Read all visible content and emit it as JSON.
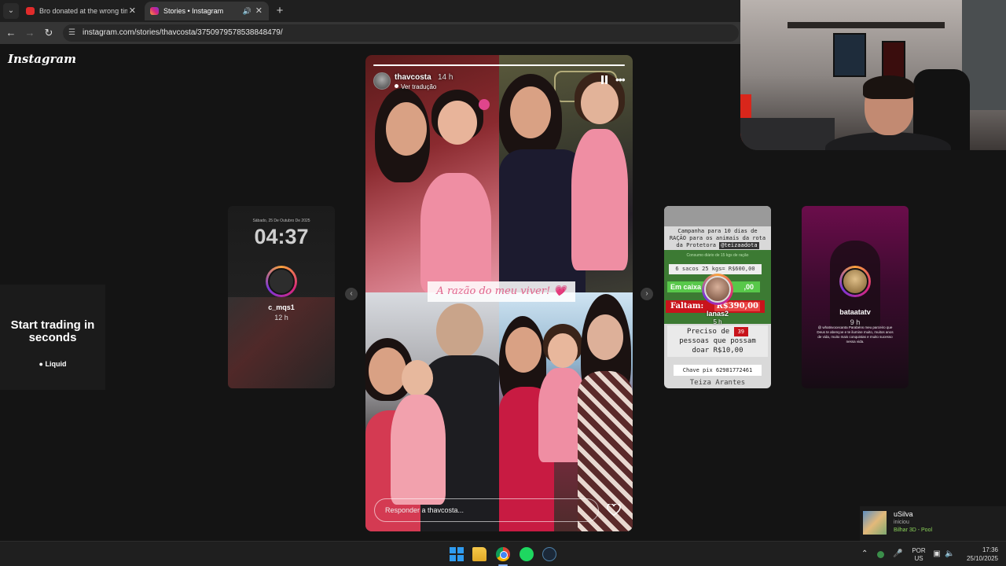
{
  "browser": {
    "tabs": [
      {
        "title": "Bro donated at the wrong time!",
        "active": false
      },
      {
        "title": "Stories • Instagram",
        "active": true
      }
    ],
    "url": "instagram.com/stories/thavcosta/3750979578538848479/"
  },
  "instagram": {
    "logo": "Instagram",
    "ad": {
      "headline": "Start trading in seconds",
      "brand": "Liquid"
    },
    "story_left": {
      "date": "Sábado, 25 De Outubro De 2025",
      "time": "04:37",
      "username": "c_mqs1",
      "age": "12 h"
    },
    "main_story": {
      "username": "thavcosta",
      "age": "14 h",
      "translate": "Ver tradução",
      "caption": "A razão do meu viver! 💗",
      "reply_placeholder": "Responder a thavcosta...",
      "progress": 1.0
    },
    "story_campaign": {
      "line1": "Campanha para 10 dias de",
      "line2": "RAÇÃO para os animais da rota",
      "line3": "da Protetora",
      "tag": "@teizaadota",
      "faint": "Consumo diário de 15 kgs de ração",
      "sacos": "6 sacos 25 kgs= R$600,00",
      "em_caixa": "Em caixa",
      "em_caixa_val": ",00",
      "faltam_label": "Faltam:",
      "faltam_val": "R$390,00",
      "preciso": "Preciso de",
      "preciso_count": "39",
      "preciso2": "pessoas que possam",
      "preciso3": "doar R$10,00",
      "chave": "Chave pix 62981772461",
      "footer": "Teiza Arantes",
      "username": "lanas2",
      "age": "5 h"
    },
    "story_right": {
      "username": "bataatatv",
      "age": "9 h",
      "caption": "@ whatsvocecanta Parabéns meu parceiro que Deus te abençoe e te ilumine muito, muitos anos de vida, muito mais conquistas e muito sucesso nessa vida."
    }
  },
  "notification": {
    "name": "uSilva",
    "status": "iniciou",
    "game": "Bilhar 3D - Pool"
  },
  "taskbar": {
    "lang_top": "POR",
    "lang_bottom": "US",
    "time": "17:36",
    "date": "25/10/2025"
  },
  "colors": {
    "ig_gradient": [
      "#f9a23b",
      "#d8267c",
      "#7b35d9"
    ],
    "caption_pink": "#e0648c",
    "faltam_red": "#c8131b"
  }
}
